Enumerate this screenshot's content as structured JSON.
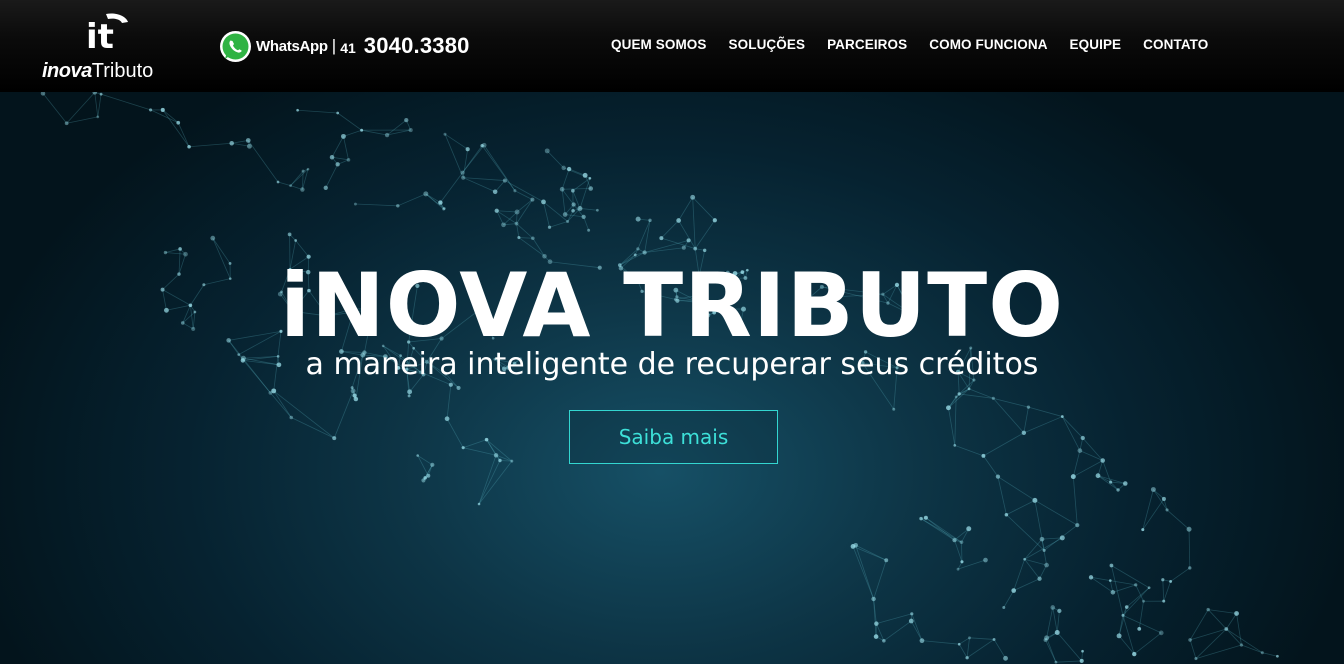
{
  "header": {
    "logo": {
      "bold": "inova",
      "light": "Tributo",
      "mark": "it"
    },
    "whatsapp": {
      "label": "WhatsApp",
      "separator": "|",
      "area_code": "41",
      "number": "3040.3380",
      "icon": "whatsapp-icon"
    },
    "nav": [
      "QUEM SOMOS",
      "SOLUÇÕES",
      "PARCEIROS",
      "COMO FUNCIONA",
      "EQUIPE",
      "CONTATO"
    ]
  },
  "hero": {
    "title": "iNOVA TRIBUTO",
    "subtitle": "a maneira inteligente de recuperar seus créditos",
    "cta_label": "Saiba mais",
    "background_art": "network-hands-illustration"
  },
  "colors": {
    "accent": "#33d6d0",
    "header_bg": "#000000",
    "hero_bg": "#0d3445"
  }
}
